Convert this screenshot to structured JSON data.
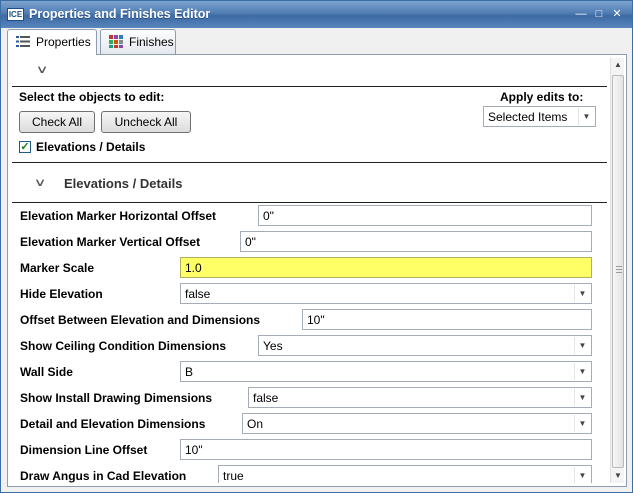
{
  "window": {
    "title": "Properties and Finishes Editor",
    "app_icon_text": "ICE"
  },
  "tabs": [
    {
      "label": "Properties",
      "active": true,
      "icon": "list-icon"
    },
    {
      "label": "Finishes",
      "active": false,
      "icon": "grid-icon"
    }
  ],
  "selection": {
    "heading": "Select the objects to edit:",
    "check_all": "Check All",
    "uncheck_all": "Uncheck All",
    "item_label": "Elevations / Details",
    "item_checked": true
  },
  "apply": {
    "heading": "Apply edits to:",
    "value": "Selected Items"
  },
  "section": {
    "title": "Elevations / Details"
  },
  "properties": [
    {
      "label": "Elevation Marker Horizontal Offset",
      "value": "0\"",
      "kind": "text"
    },
    {
      "label": "Elevation Marker Vertical Offset",
      "value": "0\"",
      "kind": "text"
    },
    {
      "label": "Marker Scale",
      "value": "1.0",
      "kind": "text",
      "highlight": true
    },
    {
      "label": "Hide Elevation",
      "value": "false",
      "kind": "select"
    },
    {
      "label": "Offset Between Elevation and Dimensions",
      "value": "10\"",
      "kind": "text"
    },
    {
      "label": "Show Ceiling Condition Dimensions",
      "value": "Yes",
      "kind": "select"
    },
    {
      "label": "Wall Side",
      "value": "B",
      "kind": "select"
    },
    {
      "label": "Show Install Drawing Dimensions",
      "value": "false",
      "kind": "select"
    },
    {
      "label": "Detail and Elevation Dimensions",
      "value": "On",
      "kind": "select"
    },
    {
      "label": "Dimension Line Offset",
      "value": "10\"",
      "kind": "text"
    },
    {
      "label": "Draw Angus in Cad Elevation",
      "value": "true",
      "kind": "select"
    }
  ],
  "colors": {
    "title_bar": "#4f7cb3",
    "highlight_field": "#ffff66"
  }
}
